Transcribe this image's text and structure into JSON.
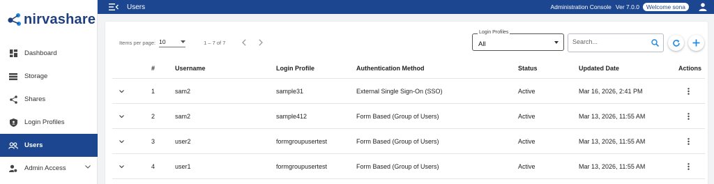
{
  "brand": {
    "logo_text": "nirvashare"
  },
  "sidebar": {
    "items": [
      {
        "label": "Dashboard",
        "icon": "dashboard-icon"
      },
      {
        "label": "Storage",
        "icon": "storage-icon"
      },
      {
        "label": "Shares",
        "icon": "share-icon"
      },
      {
        "label": "Login Profiles",
        "icon": "shield-icon"
      },
      {
        "label": "Users",
        "icon": "users-icon",
        "active": true
      },
      {
        "label": "Admin Access",
        "icon": "admin-access-icon"
      }
    ]
  },
  "topbar": {
    "title": "Users",
    "console": "Administration Console",
    "version": "Ver 7.0.0",
    "welcome": "Welcome sona"
  },
  "toolbar": {
    "items_per_page_label": "Items per page:",
    "items_per_page_value": "10",
    "range_label": "1 – 7 of 7",
    "login_profiles_label": "Login Profiles",
    "login_profiles_value": "All",
    "search_placeholder": "Search..."
  },
  "table": {
    "columns": [
      "#",
      "Username",
      "Login Profile",
      "Authentication Method",
      "Status",
      "Updated Date",
      "Actions"
    ],
    "rows": [
      {
        "num": "1",
        "username": "sam2",
        "profile": "sample31",
        "auth": "External Single Sign-On (SSO)",
        "status": "Active",
        "updated": "Mar 16, 2026, 2:41 PM"
      },
      {
        "num": "2",
        "username": "sam2",
        "profile": "sample412",
        "auth": "Form Based (Group of Users)",
        "status": "Active",
        "updated": "Mar 13, 2026, 11:55 AM"
      },
      {
        "num": "3",
        "username": "user2",
        "profile": "formgroupusertest",
        "auth": "Form Based (Group of Users)",
        "status": "Active",
        "updated": "Mar 13, 2026, 11:55 AM"
      },
      {
        "num": "4",
        "username": "user1",
        "profile": "formgroupusertest",
        "auth": "Form Based (Group of Users)",
        "status": "Active",
        "updated": "Mar 13, 2026, 11:55 AM"
      }
    ]
  },
  "colors": {
    "primary": "#1d4691",
    "accent": "#1e88e5"
  }
}
